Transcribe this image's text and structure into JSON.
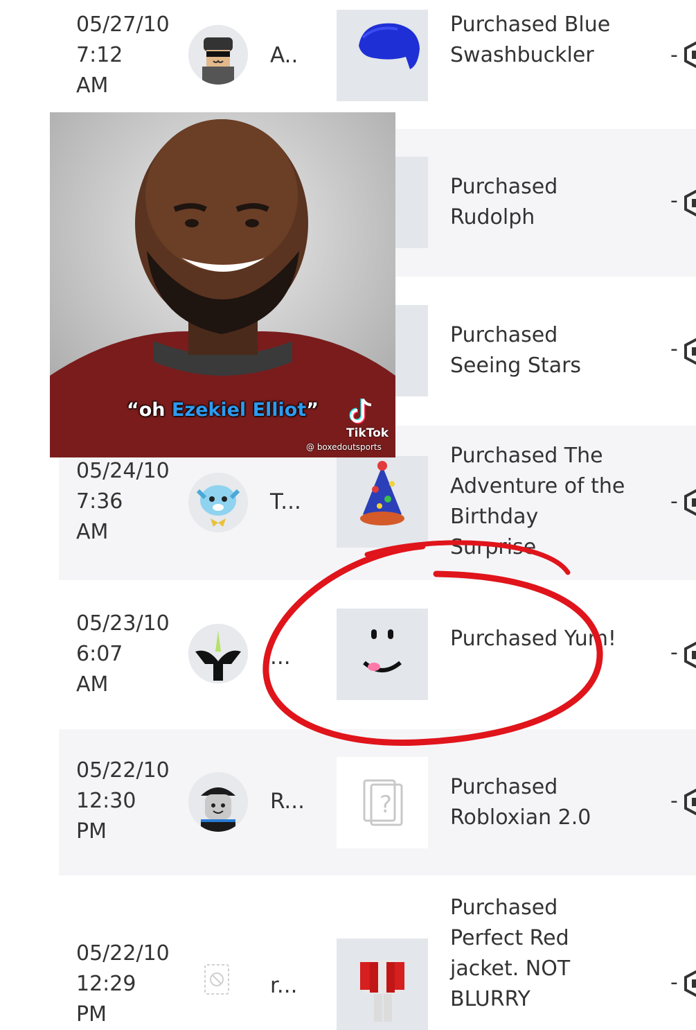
{
  "rows": [
    {
      "date": "05/27/10",
      "time": "7:12",
      "ampm": "AM",
      "user": "A..",
      "description": "Purchased Blue Swashbuckler",
      "amount": "-"
    },
    {
      "date": "",
      "time": "",
      "ampm": "",
      "user": "",
      "description": "Purchased Rudolph",
      "amount": "-"
    },
    {
      "date": "",
      "time": "",
      "ampm": "",
      "user": "",
      "description": "Purchased Seeing Stars",
      "amount": "-"
    },
    {
      "date": "05/24/10",
      "time": "7:36",
      "ampm": "AM",
      "user": "T...",
      "description": "Purchased The Adventure of the Birthday Surprise",
      "amount": "-"
    },
    {
      "date": "05/23/10",
      "time": "6:07",
      "ampm": "AM",
      "user": "...",
      "description": "Purchased Yum!",
      "amount": "-"
    },
    {
      "date": "05/22/10",
      "time": "12:30",
      "ampm": "PM",
      "user": "R...",
      "description": "Purchased Robloxian 2.0",
      "amount": "-"
    },
    {
      "date": "05/22/10",
      "time": "12:29",
      "ampm": "PM",
      "user": "r...",
      "description": "Purchased Perfect Red jacket. NOT BLURRY",
      "amount": "-"
    }
  ],
  "overlay": {
    "caption_prefix": "“oh ",
    "caption_highlight": "Ezekiel Elliot",
    "caption_suffix": "”",
    "platform": "TikTok",
    "handle": "@ boxedoutsports"
  },
  "colors": {
    "row_shade": "#f5f5f7",
    "thumb_bg": "#e3e6ea",
    "annotation_red": "#e0141b",
    "caption_highlight": "#2d9bef"
  }
}
